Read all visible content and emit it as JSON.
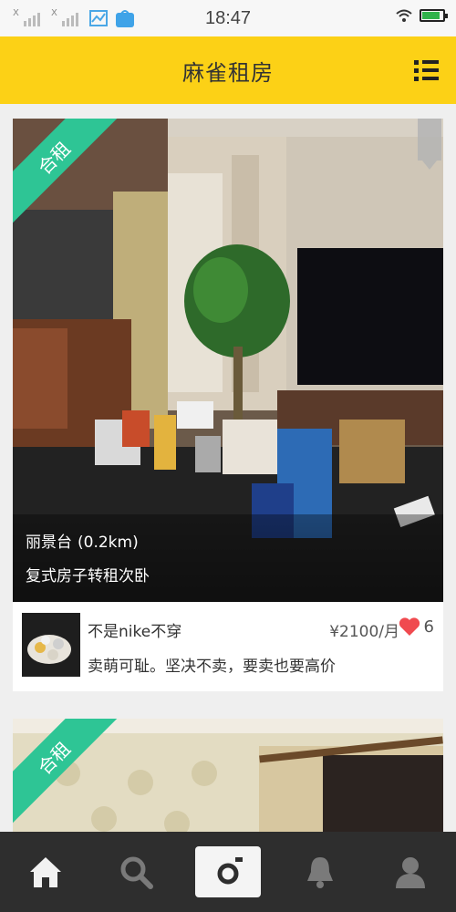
{
  "status_bar": {
    "time": "18:47",
    "battery_level": 0.85,
    "signal_marker": "X"
  },
  "app_bar": {
    "title": "麻雀租房",
    "menu_icon": "list-menu-icon"
  },
  "listings": [
    {
      "badge": "合租",
      "location": "丽景台",
      "distance": "(0.2km)",
      "description": "复式房子转租次卧",
      "user_name": "不是nike不穿",
      "price": "¥2100/月",
      "like_count": "6",
      "bio": "卖萌可耻。坚决不卖，要卖也要高价"
    },
    {
      "badge": "合租"
    }
  ],
  "tab_bar": {
    "tabs": [
      "home-icon",
      "search-icon",
      "camera-icon",
      "bell-icon",
      "profile-icon"
    ]
  },
  "colors": {
    "accent": "#fcd116",
    "badge": "#2ec595",
    "heart": "#f04a4f",
    "tab_bar_bg": "#2e2e2e"
  }
}
